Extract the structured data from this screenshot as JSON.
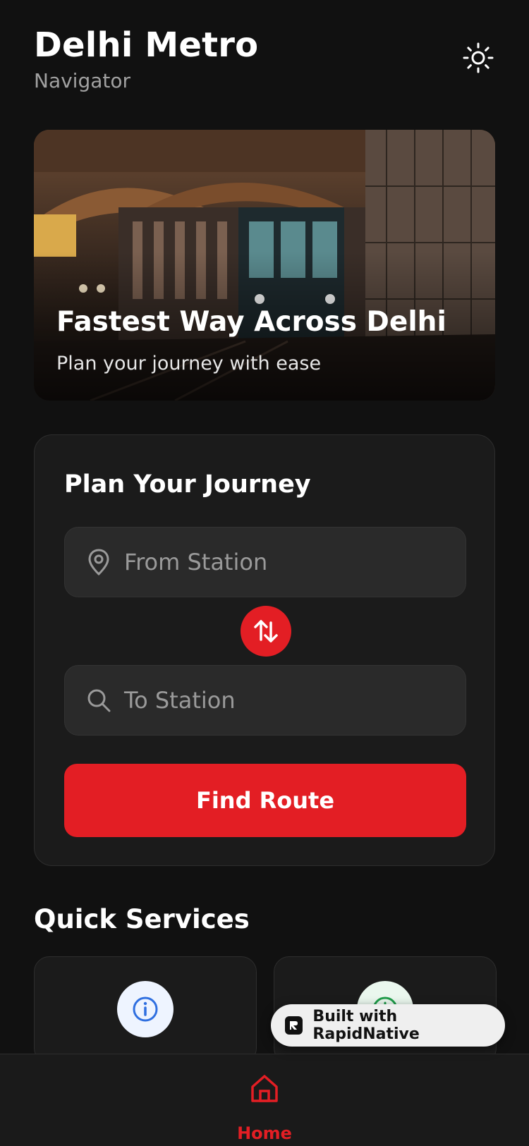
{
  "header": {
    "title": "Delhi Metro",
    "subtitle": "Navigator",
    "theme_icon": "sun-icon"
  },
  "hero": {
    "title": "Fastest Way Across Delhi",
    "subtitle": "Plan your journey with ease"
  },
  "planner": {
    "title": "Plan Your Journey",
    "from": {
      "placeholder": "From Station",
      "icon": "map-pin-icon"
    },
    "to": {
      "placeholder": "To Station",
      "icon": "search-icon"
    },
    "swap_icon": "swap-vertical-icon",
    "find_label": "Find Route"
  },
  "services": {
    "title": "Quick Services",
    "items": [
      {
        "icon": "info-icon"
      },
      {
        "icon": "clock-icon"
      }
    ]
  },
  "badge": {
    "label": "Built with RapidNative"
  },
  "tabs": {
    "home_label": "Home",
    "home_icon": "home-icon"
  },
  "colors": {
    "accent": "#e31e24",
    "background": "#111111",
    "card": "#1b1b1b",
    "input": "#2a2a2a",
    "info": "#2f6fe0",
    "clock": "#1f9d4a"
  }
}
